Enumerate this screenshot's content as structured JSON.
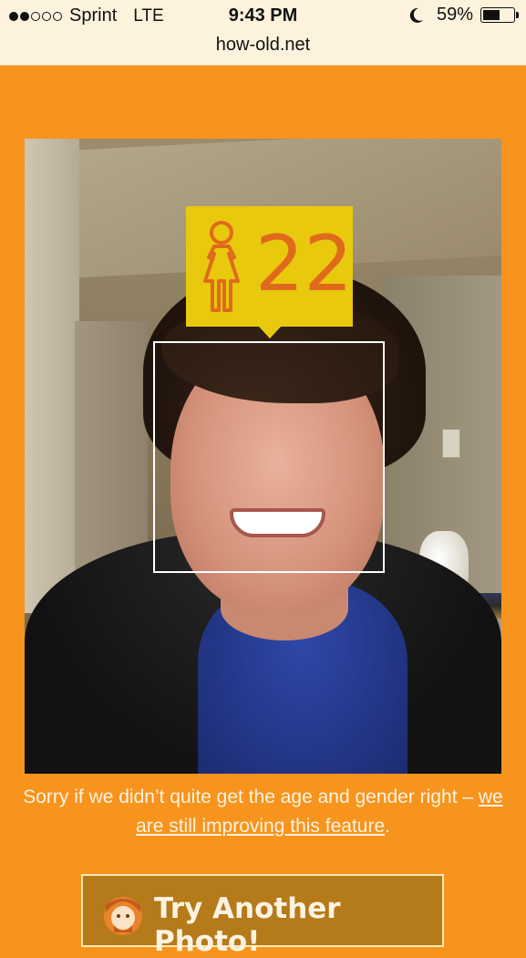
{
  "status_bar": {
    "carrier": "Sprint",
    "network": "LTE",
    "time": "9:43 PM",
    "battery": "59%",
    "battery_level": 0.59,
    "url": "how-old.net",
    "icons": [
      "signal-dots-icon",
      "moon-icon",
      "battery-icon"
    ]
  },
  "result": {
    "age": "22",
    "gender_icon": "female-icon"
  },
  "message": {
    "text": "Sorry if we didn’t quite get the age and gender right – ",
    "link_text": "we are still improving this feature",
    "suffix": "."
  },
  "action": {
    "label": "Try Another Photo!",
    "icon": "face-avatar-icon"
  },
  "colors": {
    "background": "#f7941e",
    "age_tag": "#e8c90d",
    "age_text": "#e06a1c",
    "button": "#b57a1a"
  }
}
